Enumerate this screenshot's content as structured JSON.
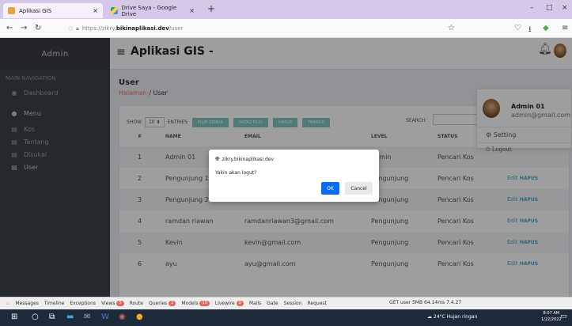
{
  "browser": {
    "tabs": [
      {
        "title": "Aplikasi GIS",
        "close": "×",
        "active": true
      },
      {
        "title": "Drive Saya - Google Drive",
        "close": "×",
        "active": false
      }
    ],
    "new_tab": "+",
    "window_controls": [
      "–",
      "□",
      "×"
    ],
    "url_prefix": "https://zikry.",
    "url_domain": "bikinaplikasi.dev",
    "url_path": "/user"
  },
  "sidebar": {
    "brand": "Admin",
    "section": "MAIN NAVIGATION",
    "dashboard": "Dashboard",
    "menu": "Menu",
    "items": [
      "Kos",
      "Tentang",
      "Disukai",
      "User"
    ]
  },
  "header": {
    "title": "Aplikasi GIS -"
  },
  "page": {
    "title": "User",
    "crumb_home": "Halaman",
    "crumb_sep": "/",
    "crumb_current": "User"
  },
  "controls": {
    "show": "SHOW",
    "show_value": "10",
    "entries": "ENTRIES",
    "buttons": [
      "PILIH SEMUA",
      "DATA2 PILIH",
      "HAPUS",
      "TAMBAH"
    ],
    "search": "SEARCH:"
  },
  "table": {
    "headers": [
      "#",
      "NAME",
      "EMAIL",
      "LEVEL",
      "STATUS"
    ],
    "rows": [
      {
        "no": "1",
        "name": "Admin 01",
        "email": "",
        "level": "Admin",
        "status": "Pencari Kos",
        "edit": "",
        "del": ""
      },
      {
        "no": "2",
        "name": "Pengunjung 1",
        "email": "",
        "level": "Pengunjung",
        "status": "Pencari Kos",
        "edit": "Edit",
        "del": "HAPUS"
      },
      {
        "no": "3",
        "name": "Pengunjung 2",
        "email": "",
        "level": "Pengunjung",
        "status": "Pencari Kos",
        "edit": "Edit",
        "del": "HAPUS"
      },
      {
        "no": "4",
        "name": "ramdan riawan",
        "email": "ramdanriawan3@gmail.com",
        "level": "Pengunjung",
        "status": "Pencari Kos",
        "edit": "Edit",
        "del": "HAPUS"
      },
      {
        "no": "5",
        "name": "Kevin",
        "email": "kevin@gmail.com",
        "level": "Pengunjung",
        "status": "Pencari Kos",
        "edit": "Edit",
        "del": "HAPUS"
      },
      {
        "no": "6",
        "name": "ayu",
        "email": "ayu@gmail.com",
        "level": "Pengunjung",
        "status": "Pencari Kos",
        "edit": "Edit",
        "del": "HAPUS"
      }
    ]
  },
  "user_menu": {
    "name": "Admin 01",
    "email": "admin@gmail.com",
    "setting": "Setting",
    "logout": "Logout"
  },
  "dialog": {
    "host": "zikry.bikinaplikasi.dev",
    "message": "Yakin akan logut?",
    "ok": "OK",
    "cancel": "Cancel"
  },
  "debugbar": {
    "items": [
      {
        "label": "Messages"
      },
      {
        "label": "Timeline"
      },
      {
        "label": "Exceptions"
      },
      {
        "label": "Views",
        "badge": "5"
      },
      {
        "label": "Route"
      },
      {
        "label": "Queries",
        "badge": "2"
      },
      {
        "label": "Models",
        "badge": "13"
      },
      {
        "label": "Livewire",
        "badge": "0"
      },
      {
        "label": "Mails"
      },
      {
        "label": "Gate"
      },
      {
        "label": "Session"
      },
      {
        "label": "Request"
      }
    ],
    "right": "GET user  5MB  64.14ms  7.4.27"
  },
  "taskbar": {
    "weather": "24°C  Hujan ringan",
    "time": "8:07 AM",
    "date": "1/22/2022"
  },
  "colors": {
    "accent": "#7fc6c1",
    "link": "#4aa3c8",
    "sidebar": "#3d4249",
    "crumb": "#e07b6b",
    "ok_button": "#0a6cf0"
  }
}
